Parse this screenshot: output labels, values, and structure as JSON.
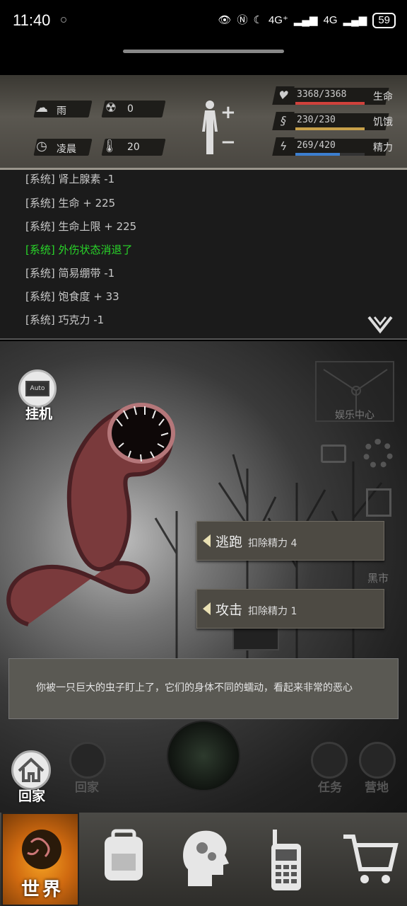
{
  "status_bar": {
    "time": "11:40",
    "signal_1": "4G⁺",
    "signal_2": "4G",
    "battery": "59"
  },
  "header": {
    "weather": "雨",
    "radiation": "0",
    "time_of_day": "凌晨",
    "temperature": "20",
    "stats": [
      {
        "value": "3368/3368",
        "name": "生命",
        "fraction": 1.0,
        "color": "#d0413b",
        "icon": "heart-icon"
      },
      {
        "value": "230/230",
        "name": "饥饿",
        "fraction": 1.0,
        "color": "#c8a14a",
        "icon": "stomach-icon"
      },
      {
        "value": "269/420",
        "name": "精力",
        "fraction": 0.64,
        "color": "#3c7fd0",
        "icon": "energy-icon"
      }
    ]
  },
  "log": {
    "lines": [
      {
        "text": "[系统] 肾上腺素 -1",
        "highlight": false
      },
      {
        "text": "[系统] 生命 + 225",
        "highlight": false
      },
      {
        "text": "[系统] 生命上限 + 225",
        "highlight": false
      },
      {
        "text": "[系统] 外伤状态消退了",
        "highlight": true
      },
      {
        "text": "[系统] 简易绷带 -1",
        "highlight": false
      },
      {
        "text": "[系统] 饱食度 + 33",
        "highlight": false
      },
      {
        "text": "[系统] 巧克力 -1",
        "highlight": false
      }
    ]
  },
  "scene": {
    "auto_screen": "Auto",
    "auto_label": "挂机",
    "entertainment_label": "娱乐中心",
    "black_market_label": "黑市",
    "actions": [
      {
        "label": "逃跑",
        "cost": "扣除精力 4"
      },
      {
        "label": "攻击",
        "cost": "扣除精力 1"
      }
    ],
    "description": "你被一只巨大的虫子盯上了，它们的身体不同的蠕动，看起来非常的恶心",
    "home_label": "回家",
    "dim_home_label": "回家",
    "task_label": "任务",
    "camp_label": "营地"
  },
  "nav": {
    "world_label": "世界"
  }
}
